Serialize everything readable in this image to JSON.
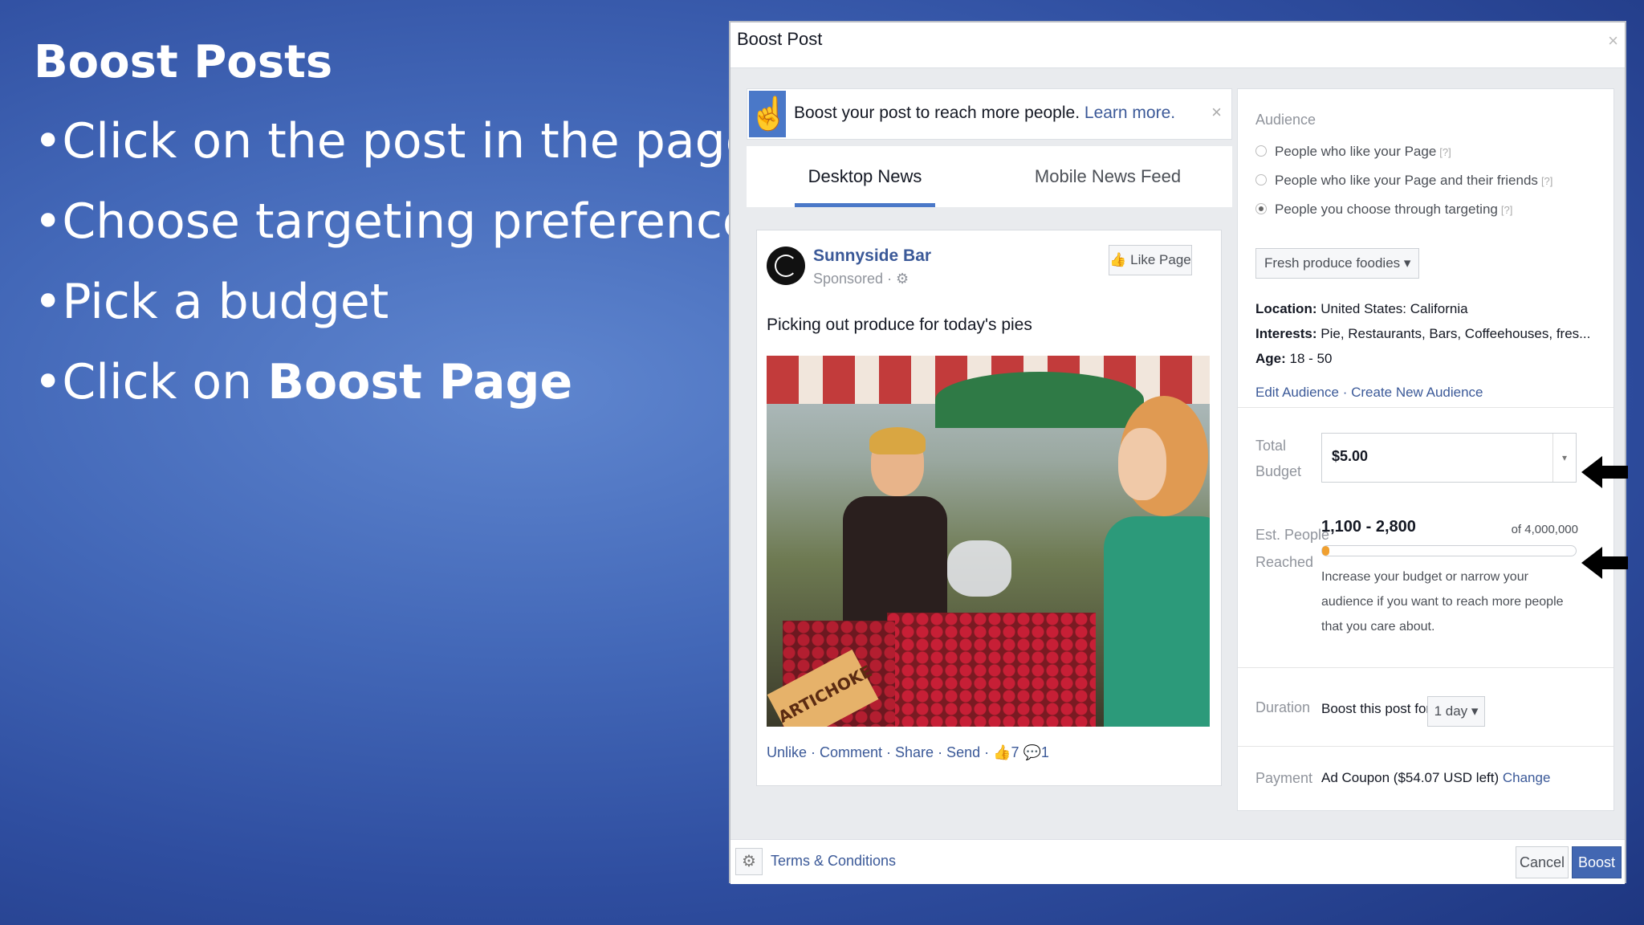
{
  "slide": {
    "title": "Boost Posts",
    "bullets": {
      "b1": "•Click on the post in the page",
      "b2": "•Choose targeting preferences",
      "b3": "•Pick a budget",
      "b4_prefix": "•Click on ",
      "b4_bold": "Boost Page"
    }
  },
  "dialog": {
    "title": "Boost Post",
    "close_glyph": "×",
    "notice": {
      "text": "Boost your post to reach more people.",
      "link": "Learn more.",
      "close_glyph": "×",
      "icon": "pointer-hand-icon"
    },
    "tabs": {
      "desktop": "Desktop News Feed",
      "mobile": "Mobile News Feed"
    },
    "post": {
      "page_name": "Sunnyside Bar",
      "sponsored": "Sponsored · ⚙",
      "like_page": "Like Page",
      "text": "Picking out produce for today's pies",
      "sign_text": "ARTICHOKE",
      "actions": "Unlike · Comment · Share · Send · 👍7 💬1"
    },
    "audience": {
      "title": "Audience",
      "options": {
        "o1": "People who like your Page",
        "o2": "People who like your Page and their friends",
        "o3": "People you choose through targeting"
      },
      "help": "[?]",
      "selected": "Fresh produce foodies ▾",
      "location_label": "Location:",
      "location_value": "United States: California",
      "interests_label": "Interests:",
      "interests_value": "Pie, Restaurants, Bars, Coffeehouses, fres...",
      "age_label": "Age:",
      "age_value": "18 - 50",
      "links": "Edit Audience · Create New Audience"
    },
    "budget": {
      "label_line1": "Total",
      "label_line2": "Budget",
      "value": "$5.00",
      "caret": "▾"
    },
    "reach": {
      "label_line1": "Est. People",
      "label_line2": "Reached",
      "range": "1,100 - 2,800",
      "total": "of 4,000,000",
      "fill_fraction": 0.03,
      "help": "Increase your budget or narrow your audience if you want to reach more people that you care about."
    },
    "duration": {
      "label": "Duration",
      "text": "Boost this post for",
      "value": "1 day ▾"
    },
    "payment": {
      "label": "Payment",
      "text": "Ad Coupon ($54.07 USD left)",
      "link": "Change"
    },
    "footer": {
      "gear": "⚙",
      "terms": "Terms & Conditions",
      "cancel": "Cancel",
      "boost": "Boost"
    }
  }
}
